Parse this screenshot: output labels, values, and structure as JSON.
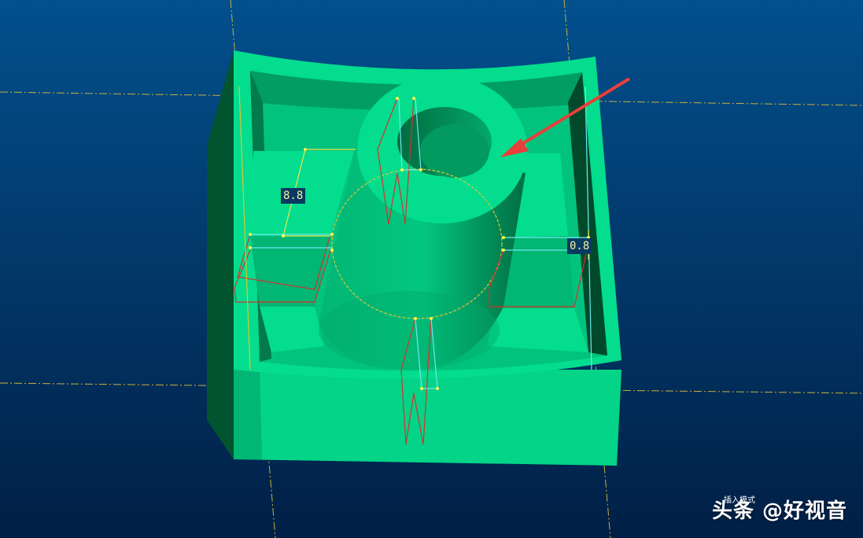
{
  "viewport": {
    "background_top": "#02508d",
    "background_bottom": "#011f45"
  },
  "model": {
    "face_color": "#03dd8d",
    "shade_color": "#018a54",
    "dark_color": "#003f24"
  },
  "annotations": {
    "dimension_left": "8.8",
    "dimension_right": "0.8",
    "arrow_color": "#e8403a"
  },
  "overlay": {
    "mode_text": "插入模式",
    "watermark": "头条 @好视音"
  }
}
